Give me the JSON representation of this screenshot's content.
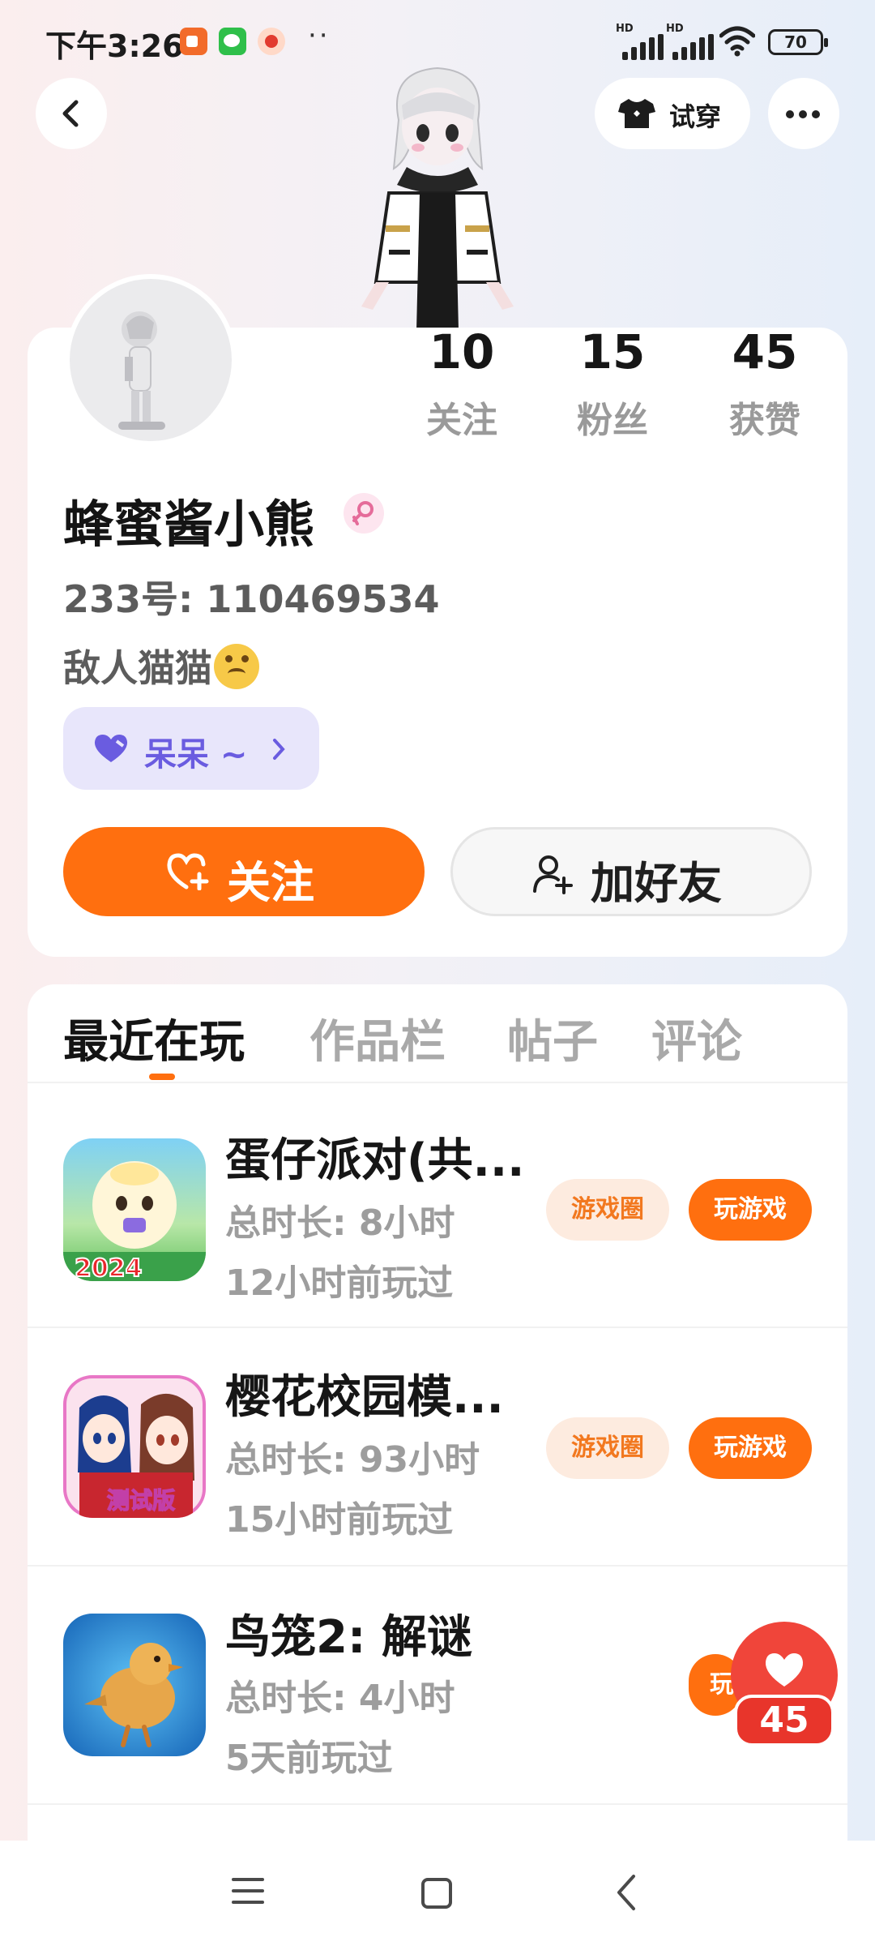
{
  "status_bar": {
    "time": "下午3:26",
    "dots": "··",
    "signal_label_1": "HD",
    "signal_label_2": "HD",
    "battery": "70"
  },
  "header": {
    "try_on_label": "试穿"
  },
  "profile": {
    "stats": {
      "following_count": "10",
      "following_label": "关注",
      "fans_count": "15",
      "fans_label": "粉丝",
      "likes_count": "45",
      "likes_label": "获赞"
    },
    "nickname": "蜂蜜酱小熊",
    "uid": "233号: 110469534",
    "bio": "敌人猫猫",
    "tag_label": "呆呆 ~",
    "follow_label": "关注",
    "add_friend_label": "加好友"
  },
  "tabs": [
    {
      "label": "最近在玩",
      "active": true
    },
    {
      "label": "作品栏",
      "active": false
    },
    {
      "label": "帖子",
      "active": false
    },
    {
      "label": "评论",
      "active": false
    }
  ],
  "games": [
    {
      "title": "蛋仔派对(共...",
      "duration": "总时长: 8小时",
      "last_played": "12小时前玩过",
      "circle_label": "游戏圈",
      "play_label": "玩游戏",
      "icon_text": "2024"
    },
    {
      "title": "樱花校园模...",
      "duration": "总时长: 93小时",
      "last_played": "15小时前玩过",
      "circle_label": "游戏圈",
      "play_label": "玩游戏",
      "icon_text": "测试版"
    },
    {
      "title": "鸟笼2: 解谜",
      "duration": "总时长: 4小时",
      "last_played": "5天前玩过",
      "play_label": "玩"
    }
  ],
  "floating_like": {
    "count": "45"
  },
  "colors": {
    "accent": "#ff6f0f",
    "tag_purple": "#6a5ce0",
    "like_red": "#f0453a"
  }
}
